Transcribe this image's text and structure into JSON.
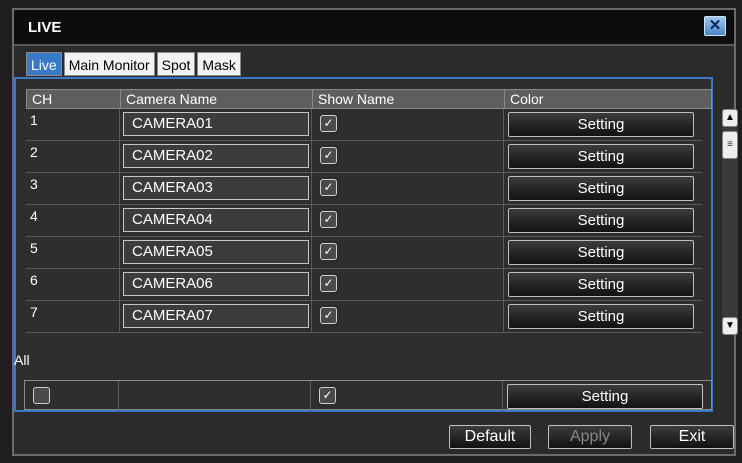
{
  "window": {
    "title": "LIVE"
  },
  "tabs": [
    "Live",
    "Main Monitor",
    "Spot",
    "Mask"
  ],
  "table": {
    "headers": [
      "CH",
      "Camera Name",
      "Show Name",
      "Color"
    ],
    "rows": [
      {
        "ch": "1",
        "name": "CAMERA01",
        "show_name": true,
        "color": "Setting"
      },
      {
        "ch": "2",
        "name": "CAMERA02",
        "show_name": true,
        "color": "Setting"
      },
      {
        "ch": "3",
        "name": "CAMERA03",
        "show_name": true,
        "color": "Setting"
      },
      {
        "ch": "4",
        "name": "CAMERA04",
        "show_name": true,
        "color": "Setting"
      },
      {
        "ch": "5",
        "name": "CAMERA05",
        "show_name": true,
        "color": "Setting"
      },
      {
        "ch": "6",
        "name": "CAMERA06",
        "show_name": true,
        "color": "Setting"
      },
      {
        "ch": "7",
        "name": "CAMERA07",
        "show_name": true,
        "color": "Setting"
      }
    ]
  },
  "all": {
    "label": "All",
    "checked": false,
    "show_name": true,
    "color": "Setting"
  },
  "buttons": {
    "default": "Default",
    "apply": "Apply",
    "exit": "Exit"
  }
}
